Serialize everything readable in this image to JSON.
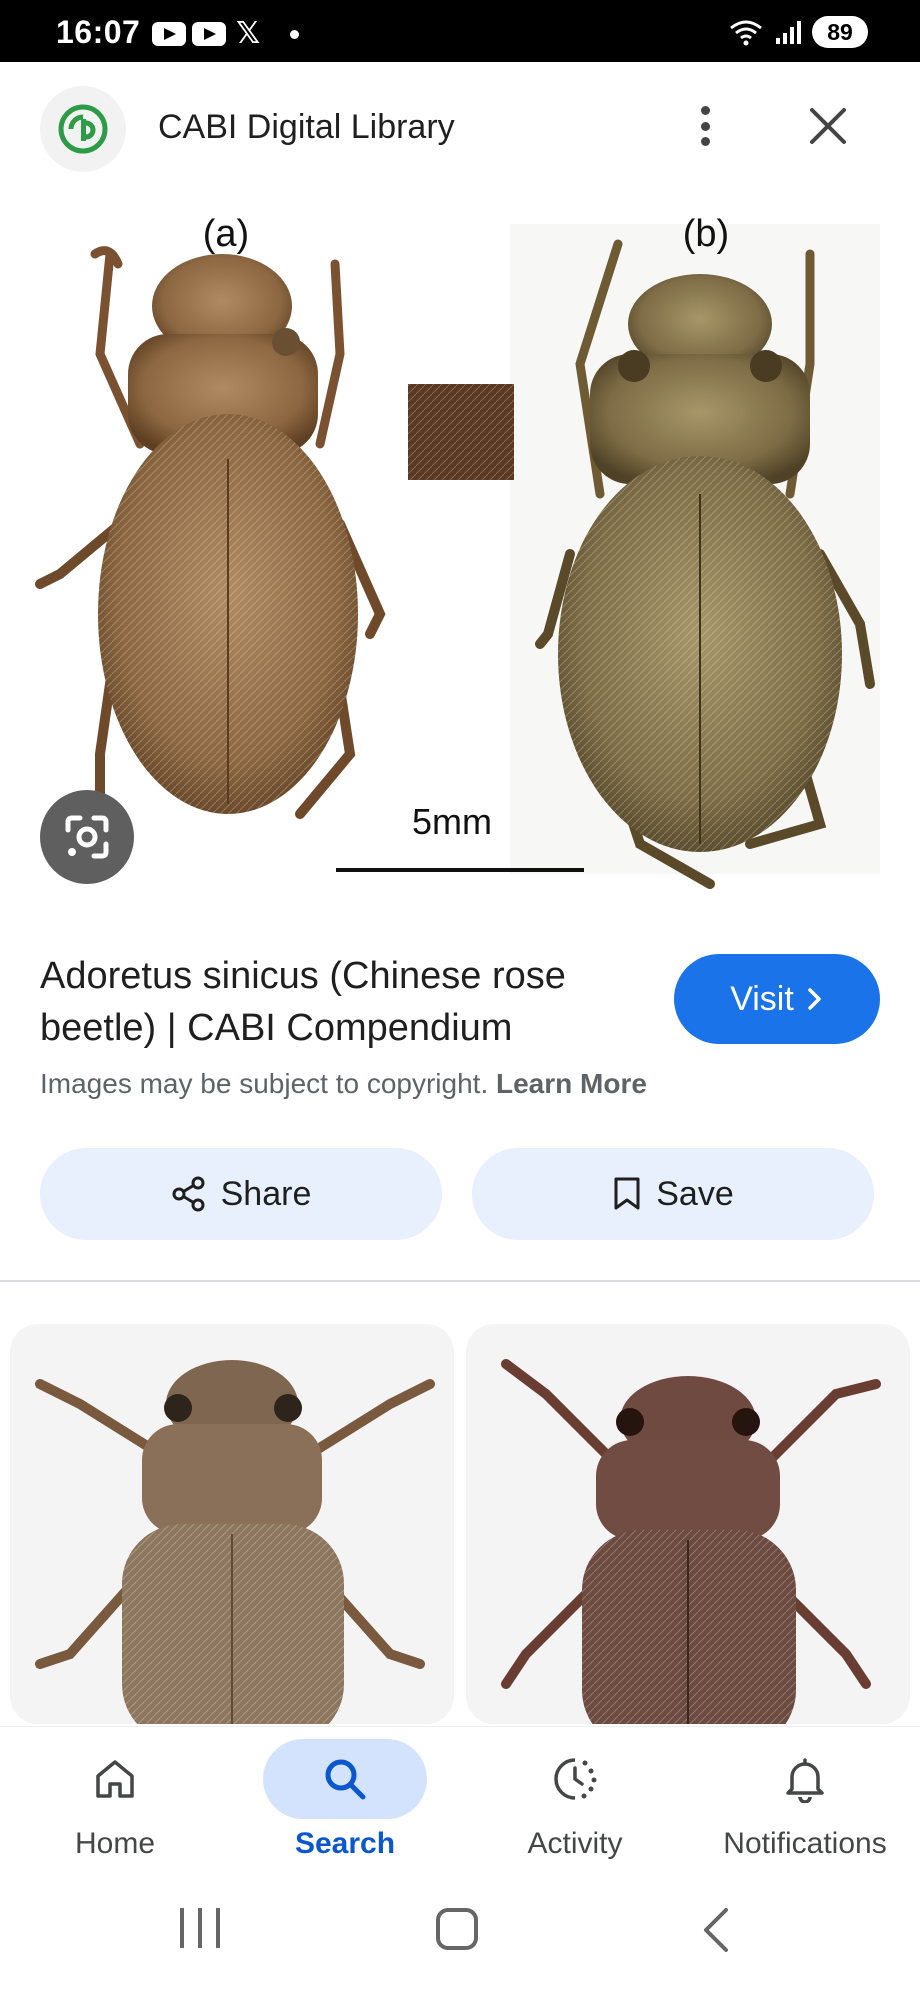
{
  "status_bar": {
    "time": "16:07",
    "notification_icons": [
      "youtube-icon",
      "youtube-icon",
      "x-icon",
      "dot-icon"
    ],
    "battery": "89"
  },
  "header": {
    "site_title": "CABI Digital Library"
  },
  "image": {
    "label_a": "(a)",
    "label_b": "(b)",
    "scale_label": "5mm"
  },
  "result": {
    "title": "Adoretus sinicus (Chinese rose beetle) | CABI Compendium",
    "visit_label": "Visit",
    "copyright_text": "Images may be subject to copyright.",
    "learn_more": "Learn More"
  },
  "actions": {
    "share_label": "Share",
    "save_label": "Save"
  },
  "bottom_nav": {
    "items": [
      {
        "label": "Home",
        "icon": "home-icon"
      },
      {
        "label": "Search",
        "icon": "search-icon"
      },
      {
        "label": "Activity",
        "icon": "activity-icon"
      },
      {
        "label": "Notifications",
        "icon": "bell-icon"
      }
    ],
    "active": "Search"
  },
  "colors": {
    "accent": "#1a73e8",
    "active_nav_text": "#0b57d0",
    "active_nav_pill": "#d3e3fd",
    "chip_bg": "#e8f0fe"
  }
}
